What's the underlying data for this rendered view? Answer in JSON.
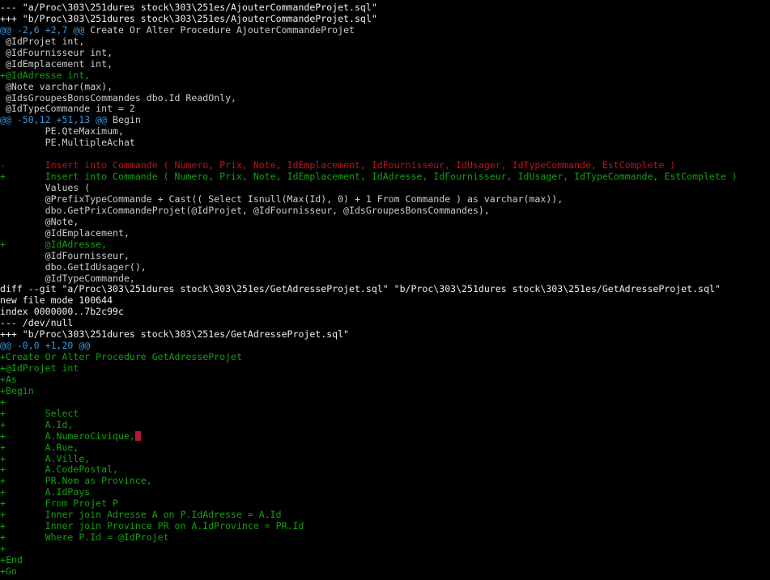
{
  "colors": {
    "background": "#000000",
    "header": "#f0f0f0",
    "hunk": "#3a96dd",
    "added": "#13a10e",
    "removed": "#c50f1f",
    "context": "#cccccc",
    "cursor": "#ad1a36"
  },
  "lines": [
    {
      "type": "header",
      "segments": [
        {
          "text": "--- \"a/Proc\\303\\251dures stock\\303\\251es/AjouterCommandeProjet.sql\"",
          "color": "white"
        }
      ]
    },
    {
      "type": "header",
      "segments": [
        {
          "text": "+++ \"b/Proc\\303\\251dures stock\\303\\251es/AjouterCommandeProjet.sql\"",
          "color": "white"
        }
      ]
    },
    {
      "type": "hunk",
      "segments": [
        {
          "text": "@@ -2,6 +2,7 @@",
          "color": "cyan"
        },
        {
          "text": " Create Or Alter Procedure AjouterCommandeProjet",
          "color": "default"
        }
      ]
    },
    {
      "type": "context",
      "segments": [
        {
          "text": " @IdProjet int,",
          "color": "default"
        }
      ]
    },
    {
      "type": "context",
      "segments": [
        {
          "text": " @IdFournisseur int,",
          "color": "default"
        }
      ]
    },
    {
      "type": "context",
      "segments": [
        {
          "text": " @IdEmplacement int,",
          "color": "default"
        }
      ]
    },
    {
      "type": "added",
      "segments": [
        {
          "text": "+@IdAdresse int,",
          "color": "green"
        }
      ]
    },
    {
      "type": "context",
      "segments": [
        {
          "text": " @Note varchar(max),",
          "color": "default"
        }
      ]
    },
    {
      "type": "context",
      "segments": [
        {
          "text": " @IdsGroupesBonsCommandes dbo.Id ReadOnly,",
          "color": "default"
        }
      ]
    },
    {
      "type": "context",
      "segments": [
        {
          "text": " @IdTypeCommande int = 2",
          "color": "default"
        }
      ]
    },
    {
      "type": "hunk",
      "segments": [
        {
          "text": "@@ -50,12 +51,13 @@",
          "color": "cyan"
        },
        {
          "text": " Begin",
          "color": "default"
        }
      ]
    },
    {
      "type": "context",
      "segments": [
        {
          "text": "        PE.QteMaximum,",
          "color": "default"
        }
      ]
    },
    {
      "type": "context",
      "segments": [
        {
          "text": "        PE.MultipleAchat",
          "color": "default"
        }
      ]
    },
    {
      "type": "context",
      "segments": [
        {
          "text": "",
          "color": "default"
        }
      ]
    },
    {
      "type": "removed",
      "segments": [
        {
          "text": "-       Insert into Commande ( Numero, Prix, Note, IdEmplacement, IdFournisseur, IdUsager, IdTypeCommande, EstComplete )",
          "color": "red"
        }
      ]
    },
    {
      "type": "added",
      "segments": [
        {
          "text": "+       Insert into Commande ( Numero, Prix, Note, IdEmplacement, IdAdresse, IdFournisseur, IdUsager, IdTypeCommande, EstComplete )",
          "color": "green"
        }
      ]
    },
    {
      "type": "context",
      "segments": [
        {
          "text": "        Values (",
          "color": "default"
        }
      ]
    },
    {
      "type": "context",
      "segments": [
        {
          "text": "        @PrefixTypeCommande + Cast(( Select Isnull(Max(Id), 0) + 1 From Commande ) as varchar(max)),",
          "color": "default"
        }
      ]
    },
    {
      "type": "context",
      "segments": [
        {
          "text": "        dbo.GetPrixCommandeProjet(@IdProjet, @IdFournisseur, @IdsGroupesBonsCommandes),",
          "color": "default"
        }
      ]
    },
    {
      "type": "context",
      "segments": [
        {
          "text": "        @Note,",
          "color": "default"
        }
      ]
    },
    {
      "type": "context",
      "segments": [
        {
          "text": "        @IdEmplacement,",
          "color": "default"
        }
      ]
    },
    {
      "type": "added",
      "segments": [
        {
          "text": "+       @IdAdresse,",
          "color": "green"
        }
      ]
    },
    {
      "type": "context",
      "segments": [
        {
          "text": "        @IdFournisseur,",
          "color": "default"
        }
      ]
    },
    {
      "type": "context",
      "segments": [
        {
          "text": "        dbo.GetIdUsager(),",
          "color": "default"
        }
      ]
    },
    {
      "type": "context",
      "segments": [
        {
          "text": "        @IdTypeCommande,",
          "color": "default"
        }
      ]
    },
    {
      "type": "header",
      "segments": [
        {
          "text": "diff --git \"a/Proc\\303\\251dures stock\\303\\251es/GetAdresseProjet.sql\" \"b/Proc\\303\\251dures stock\\303\\251es/GetAdresseProjet.sql\"",
          "color": "white"
        }
      ]
    },
    {
      "type": "header",
      "segments": [
        {
          "text": "new file mode 100644",
          "color": "white"
        }
      ]
    },
    {
      "type": "header",
      "segments": [
        {
          "text": "index 0000000..7b2c99c",
          "color": "white"
        }
      ]
    },
    {
      "type": "header",
      "segments": [
        {
          "text": "--- /dev/null",
          "color": "white"
        }
      ]
    },
    {
      "type": "header",
      "segments": [
        {
          "text": "+++ \"b/Proc\\303\\251dures stock\\303\\251es/GetAdresseProjet.sql\"",
          "color": "white"
        }
      ]
    },
    {
      "type": "hunk",
      "segments": [
        {
          "text": "@@ -0,0 +1,20 @@",
          "color": "cyan"
        }
      ]
    },
    {
      "type": "added",
      "segments": [
        {
          "text": "+Create Or Alter Procedure GetAdresseProjet",
          "color": "green"
        }
      ]
    },
    {
      "type": "added",
      "segments": [
        {
          "text": "+@IdProjet int",
          "color": "green"
        }
      ]
    },
    {
      "type": "added",
      "segments": [
        {
          "text": "+As",
          "color": "green"
        }
      ]
    },
    {
      "type": "added",
      "segments": [
        {
          "text": "+Begin",
          "color": "green"
        }
      ]
    },
    {
      "type": "added",
      "segments": [
        {
          "text": "+",
          "color": "green"
        }
      ]
    },
    {
      "type": "added",
      "segments": [
        {
          "text": "+       Select",
          "color": "green"
        }
      ]
    },
    {
      "type": "added",
      "segments": [
        {
          "text": "+       A.Id,",
          "color": "green"
        }
      ]
    },
    {
      "type": "added",
      "segments": [
        {
          "text": "+       A.NumeroCivique,",
          "color": "green"
        }
      ],
      "cursor": true
    },
    {
      "type": "added",
      "segments": [
        {
          "text": "+       A.Rue,",
          "color": "green"
        }
      ]
    },
    {
      "type": "added",
      "segments": [
        {
          "text": "+       A.Ville,",
          "color": "green"
        }
      ]
    },
    {
      "type": "added",
      "segments": [
        {
          "text": "+       A.CodePostal,",
          "color": "green"
        }
      ]
    },
    {
      "type": "added",
      "segments": [
        {
          "text": "+       PR.Nom as Province,",
          "color": "green"
        }
      ]
    },
    {
      "type": "added",
      "segments": [
        {
          "text": "+       A.IdPays",
          "color": "green"
        }
      ]
    },
    {
      "type": "added",
      "segments": [
        {
          "text": "+       From Projet P",
          "color": "green"
        }
      ]
    },
    {
      "type": "added",
      "segments": [
        {
          "text": "+       Inner join Adresse A on P.IdAdresse = A.Id",
          "color": "green"
        }
      ]
    },
    {
      "type": "added",
      "segments": [
        {
          "text": "+       Inner join Province PR on A.IdProvince = PR.Id",
          "color": "green"
        }
      ]
    },
    {
      "type": "added",
      "segments": [
        {
          "text": "+       Where P.Id = @IdProjet",
          "color": "green"
        }
      ]
    },
    {
      "type": "added",
      "segments": [
        {
          "text": "+",
          "color": "green"
        }
      ]
    },
    {
      "type": "added",
      "segments": [
        {
          "text": "+End",
          "color": "green"
        }
      ]
    },
    {
      "type": "added",
      "segments": [
        {
          "text": "+Go",
          "color": "green"
        }
      ]
    }
  ]
}
